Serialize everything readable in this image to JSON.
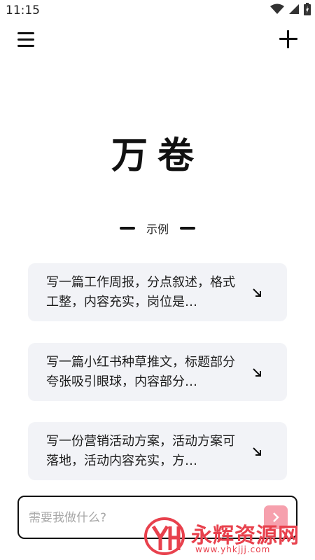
{
  "status_bar": {
    "time": "11:15"
  },
  "app": {
    "title": "万卷"
  },
  "examples": {
    "label": "示例",
    "items": [
      {
        "text": "写一篇工作周报，分点叙述，格式工整，内容充实，岗位是…"
      },
      {
        "text": "写一篇小红书种草推文，标题部分夸张吸引眼球，内容部分…"
      },
      {
        "text": "写一份营销活动方案，活动方案可落地，活动内容充实，方…"
      }
    ]
  },
  "input": {
    "placeholder": "需要我做什么?",
    "value": ""
  },
  "watermark": {
    "name": "永辉资源网",
    "url": "www.yhkjjj.com"
  },
  "colors": {
    "send_button": "#f6a0ad",
    "card_bg": "#f2f3f7",
    "watermark": "#e8414d"
  }
}
